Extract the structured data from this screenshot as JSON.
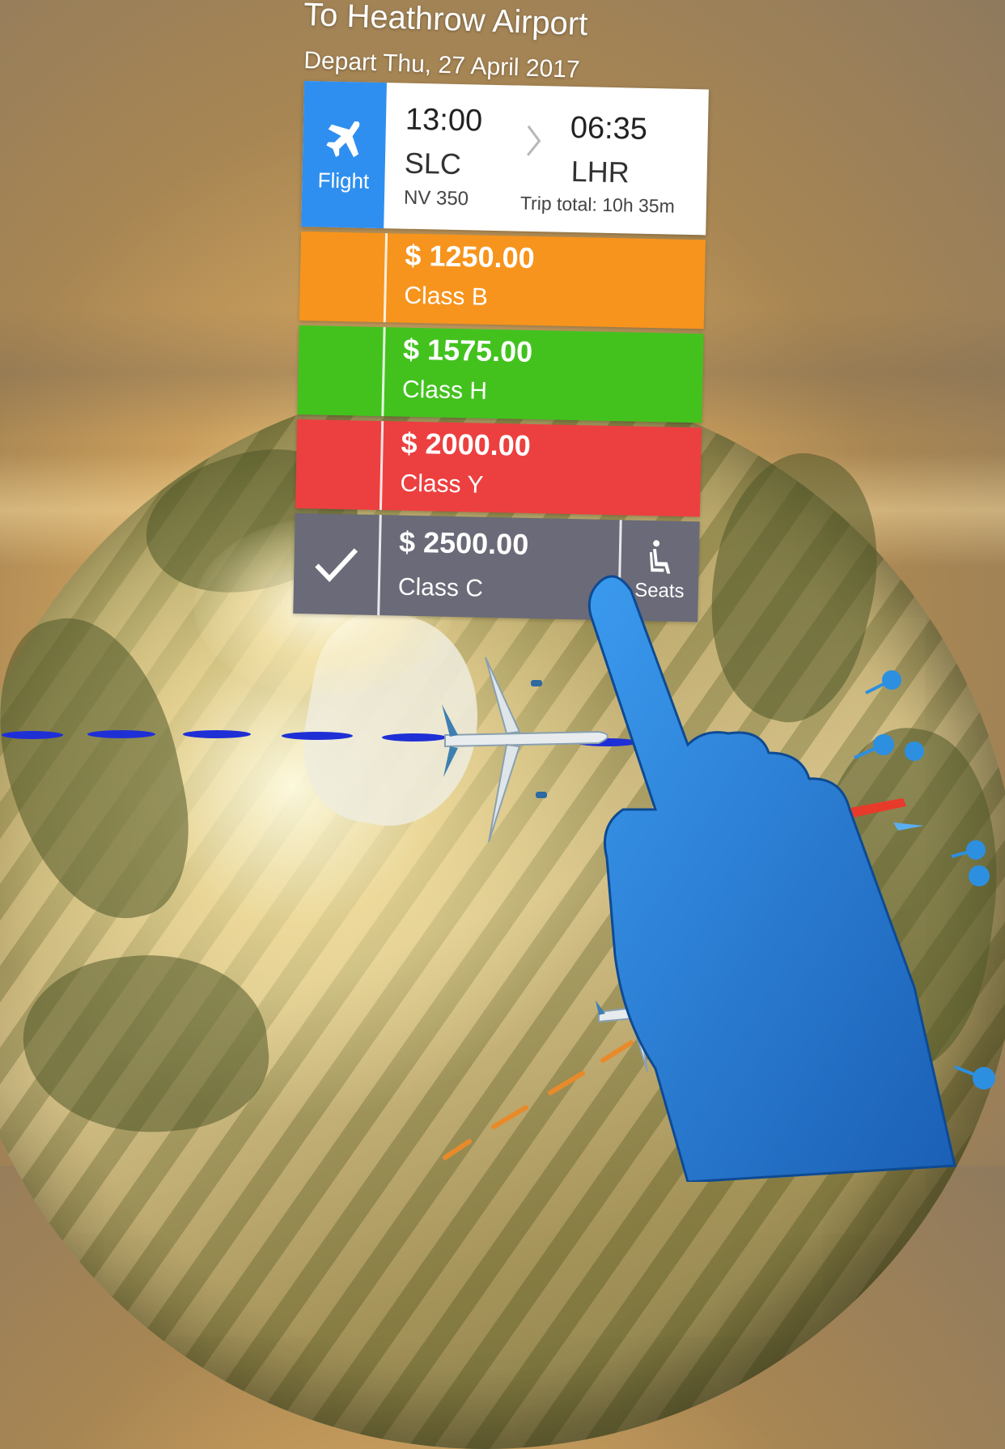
{
  "header": {
    "title": "To Heathrow Airport",
    "depart": "Depart Thu, 27 April 2017"
  },
  "flight": {
    "tab_label": "Flight",
    "tab_icon": "airplane-icon",
    "departure_time": "13:00",
    "departure_code": "SLC",
    "flight_number": "NV 350",
    "arrival_time": "06:35",
    "arrival_code": "LHR",
    "trip_total": "Trip total: 10h 35m"
  },
  "fares": [
    {
      "price": "$ 1250.00",
      "class": "Class B",
      "color": "#f7941d",
      "selected": false
    },
    {
      "price": "$ 1575.00",
      "class": "Class H",
      "color": "#43c21e",
      "selected": false
    },
    {
      "price": "$ 2000.00",
      "class": "Class Y",
      "color": "#ec4040",
      "selected": false
    },
    {
      "price": "$ 2500.00",
      "class": "Class C",
      "color": "#6a6a78",
      "selected": true
    }
  ],
  "seats": {
    "label": "Seats",
    "icon": "seat-icon"
  },
  "colors": {
    "flight_tab": "#2f8ff0",
    "route_line": "#1f2fd6",
    "hand": "#2a7fd8"
  }
}
